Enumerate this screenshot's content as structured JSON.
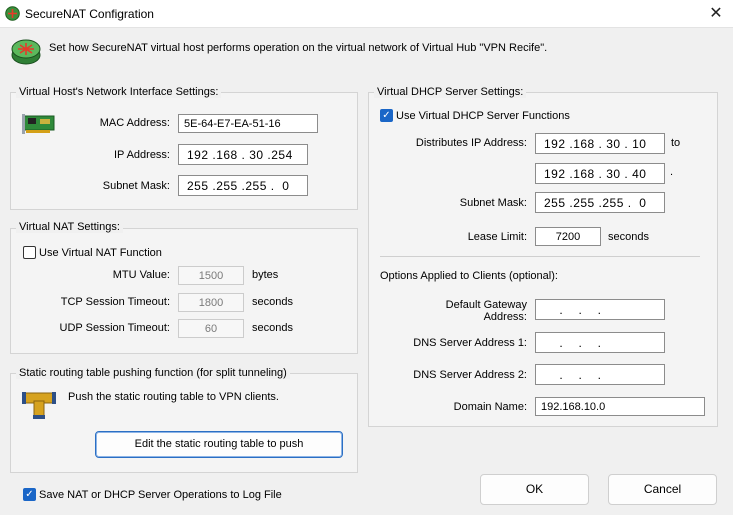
{
  "window": {
    "title": "SecureNAT Configration",
    "close_glyph": "✕"
  },
  "header": {
    "description": "Set how SecureNAT virtual host performs operation on the virtual network of Virtual Hub \"VPN Recife\"."
  },
  "host": {
    "group_label": "Virtual Host's Network Interface Settings:",
    "mac_label": "MAC Address:",
    "mac_value": "5E-64-E7-EA-51-16",
    "ip_label": "IP Address:",
    "ip_value": "192 .168 . 30 .254",
    "mask_label": "Subnet Mask:",
    "mask_value": "255 .255 .255 .  0"
  },
  "nat": {
    "group_label": "Virtual NAT Settings:",
    "use_label": "Use Virtual NAT Function",
    "use_checked": false,
    "mtu_label": "MTU Value:",
    "mtu_value": "1500",
    "mtu_unit": "bytes",
    "tcp_label": "TCP Session Timeout:",
    "tcp_value": "1800",
    "tcp_unit": "seconds",
    "udp_label": "UDP Session Timeout:",
    "udp_value": "60",
    "udp_unit": "seconds"
  },
  "routing": {
    "group_label": "Static routing table pushing function (for split tunneling)",
    "description": "Push the static routing table to VPN clients.",
    "edit_button": "Edit the static routing table to push"
  },
  "dhcp": {
    "group_label": "Virtual DHCP Server Settings:",
    "use_label": "Use Virtual DHCP Server Functions",
    "use_checked": true,
    "dist_label": "Distributes IP Address:",
    "dist_start": "192 .168 . 30 . 10",
    "to_label": "to",
    "dist_end": "192 .168 . 30 . 40",
    "end_dot": ".",
    "mask_label": "Subnet Mask:",
    "mask_value": "255 .255 .255 .  0",
    "lease_label": "Lease Limit:",
    "lease_value": "7200",
    "lease_unit": "seconds",
    "options_label": "Options Applied to Clients (optional):",
    "gateway_label_1": "Default Gateway",
    "gateway_label_2": "Address:",
    "gateway_value": "    .    .    .   ",
    "dns1_label": "DNS Server Address 1:",
    "dns1_value": "    .    .    .   ",
    "dns2_label": "DNS Server Address 2:",
    "dns2_value": "    .    .    .   ",
    "domain_label": "Domain Name:",
    "domain_value": "192.168.10.0"
  },
  "footer": {
    "log_label": "Save NAT or DHCP Server Operations to Log File",
    "log_checked": true,
    "ok_button": "OK",
    "cancel_button": "Cancel"
  },
  "icons": {
    "window_icon": "router-icon",
    "header_icon": "router-icon",
    "nic_icon": "network-card-icon",
    "routing_icon": "pipe-junction-icon",
    "check_glyph": "✓"
  }
}
